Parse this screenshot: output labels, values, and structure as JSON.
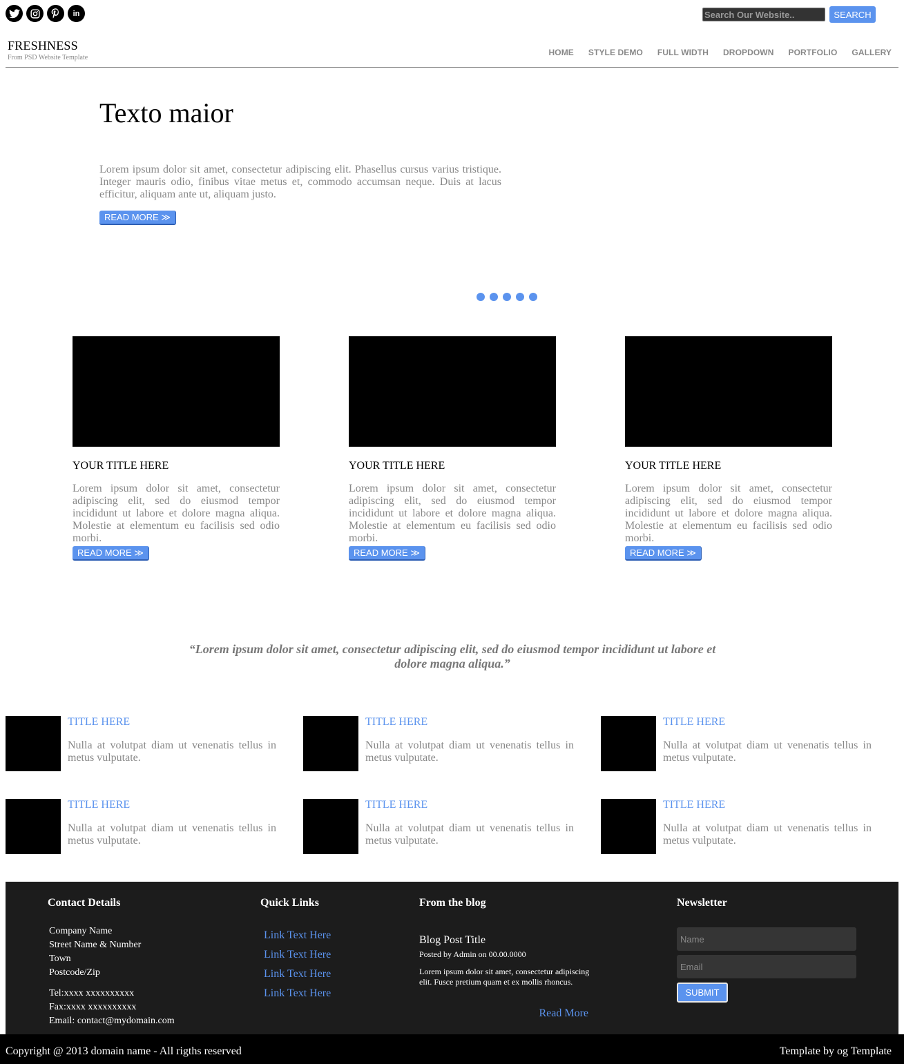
{
  "social": [
    {
      "name": "twitter-icon",
      "glyph": "t"
    },
    {
      "name": "instagram-icon",
      "glyph": "◙"
    },
    {
      "name": "pinterest-icon",
      "glyph": "P"
    },
    {
      "name": "linkedin-icon",
      "glyph": "in"
    }
  ],
  "search": {
    "placeholder": "Search Our Website..",
    "button": "SEARCH"
  },
  "brand": {
    "name": "FRESHNESS",
    "tagline": "From PSD Website Template"
  },
  "nav": [
    "HOME",
    "STYLE DEMO",
    "FULL WIDTH",
    "DROPDOWN",
    "PORTFOLIO",
    "GALLERY"
  ],
  "hero": {
    "title": "Texto maior",
    "text": "Lorem ipsum dolor sit amet, consectetur adipiscing elit. Phasellus cursus varius tristique. Integer mauris odio, finibus vitae metus et, commodo accumsan neque. Duis at lacus efficitur, aliquam ante ut, aliquam justo.",
    "button": "READ MORE ≫"
  },
  "slider_dots": 5,
  "features": [
    {
      "title": "YOUR TITLE HERE",
      "text": "Lorem ipsum dolor sit amet, consectetur adipiscing elit, sed do eiusmod tempor incididunt ut labore et dolore magna aliqua. Molestie at elementum eu facilisis sed odio morbi.",
      "button": "READ MORE ≫"
    },
    {
      "title": "YOUR TITLE HERE",
      "text": "Lorem ipsum dolor sit amet, consectetur adipiscing elit, sed do eiusmod tempor incididunt ut labore et dolore magna aliqua. Molestie at elementum eu facilisis sed odio morbi.",
      "button": "READ MORE ≫"
    },
    {
      "title": "YOUR TITLE HERE",
      "text": "Lorem ipsum dolor sit amet, consectetur adipiscing elit, sed do eiusmod tempor incididunt ut labore et dolore magna aliqua. Molestie at elementum eu facilisis sed odio morbi.",
      "button": "READ MORE ≫"
    }
  ],
  "quote": "“Lorem ipsum dolor sit amet, consectetur adipiscing elit, sed do eiusmod tempor incididunt ut labore et dolore magna aliqua.”",
  "mini_items": [
    {
      "title": "TITLE HERE",
      "text": "Nulla at volutpat diam ut venenatis tellus in metus vulputate."
    },
    {
      "title": "TITLE HERE",
      "text": "Nulla at volutpat diam ut venenatis tellus in metus vulputate."
    },
    {
      "title": "TITLE HERE",
      "text": "Nulla at volutpat diam ut venenatis tellus in metus vulputate."
    },
    {
      "title": "TITLE HERE",
      "text": "Nulla at volutpat diam ut venenatis tellus in metus vulputate."
    },
    {
      "title": "TITLE HERE",
      "text": "Nulla at volutpat diam ut venenatis tellus in metus vulputate."
    },
    {
      "title": "TITLE HERE",
      "text": "Nulla at volutpat diam ut venenatis tellus in metus vulputate."
    }
  ],
  "footer": {
    "contact": {
      "heading": "Contact Details",
      "company": "Company Name",
      "street": "Street Name & Number",
      "town": "Town",
      "postcode": "Postcode/Zip",
      "tel": "Tel:xxxx xxxxxxxxxx",
      "fax": "Fax:xxxx xxxxxxxxxx",
      "email": "Email: contact@mydomain.com"
    },
    "links": {
      "heading": "Quick Links",
      "items": [
        "Link Text Here",
        "Link Text Here",
        "Link Text Here",
        "Link Text Here"
      ]
    },
    "blog": {
      "heading": "From the blog",
      "post_title": "Blog Post Title",
      "meta": "Posted by Admin on 00.00.0000",
      "excerpt": "Lorem ipsum dolor sit amet, consectetur adipiscing elit. Fusce pretium quam et ex mollis rhoncus.",
      "read_more": "Read More"
    },
    "newsletter": {
      "heading": "Newsletter",
      "name_placeholder": "Name",
      "email_placeholder": "Email",
      "submit": "SUBMIT"
    }
  },
  "copyright": {
    "left": "Copyright @ 2013 domain name - All rigths reserved",
    "right": "Template by og Template"
  },
  "colors": {
    "accent": "#5b93ee",
    "footer_bg": "#1c1c1c",
    "copy_bg": "#000000",
    "muted_text": "#888888"
  }
}
